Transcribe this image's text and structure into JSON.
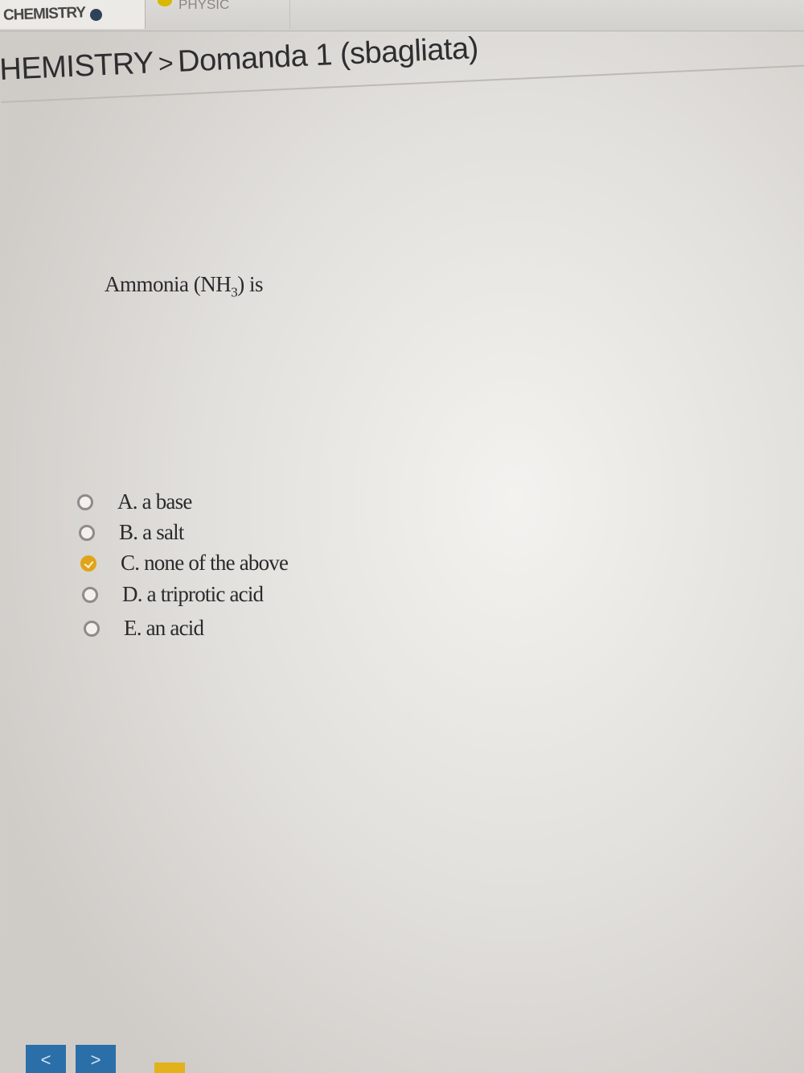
{
  "tabs": [
    {
      "label": "CHEMISTRY",
      "status_icon": "circle-filled-icon"
    },
    {
      "label": "PHYSIC",
      "status_icon": "circle-filled-icon"
    }
  ],
  "breadcrumb": {
    "course": "HEMISTRY",
    "separator": ">",
    "current": "Domanda 1 (sbagliata)"
  },
  "question": {
    "text_prefix": "Ammonia (NH",
    "subscript": "3",
    "text_suffix": ") is"
  },
  "options": [
    {
      "label": "A. a base",
      "selected": false
    },
    {
      "label": "B. a salt",
      "selected": false
    },
    {
      "label": "C. none of the above",
      "selected": true
    },
    {
      "label": "D. a triprotic acid",
      "selected": false
    },
    {
      "label": "E. an acid",
      "selected": false
    }
  ],
  "navigation": {
    "prev_symbol": "<",
    "next_symbol": ">"
  },
  "colors": {
    "selected_accent": "#e0a31a",
    "nav_button": "#2b6fa8"
  }
}
